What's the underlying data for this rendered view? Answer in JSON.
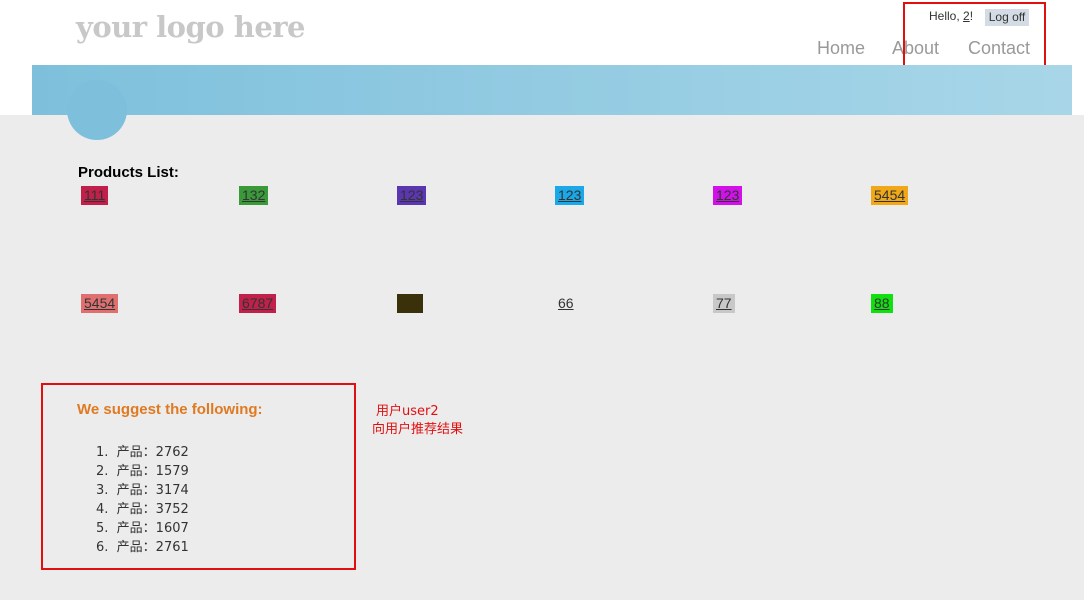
{
  "header": {
    "logo": "your logo here",
    "greeting_prefix": "Hello, ",
    "username": "2",
    "greeting_suffix": "!",
    "logoff_label": "Log off"
  },
  "nav": [
    {
      "label": "Home"
    },
    {
      "label": "About"
    },
    {
      "label": "Contact"
    }
  ],
  "products": {
    "title": "Products List:",
    "items": [
      {
        "label": "111",
        "color": "#c0204a"
      },
      {
        "label": "132",
        "color": "#3a9a3a"
      },
      {
        "label": "123",
        "color": "#5a36b0"
      },
      {
        "label": "123",
        "color": "#1aa8e8"
      },
      {
        "label": "123",
        "color": "#d012e8"
      },
      {
        "label": "5454",
        "color": "#f0a818"
      },
      {
        "label": "5454",
        "color": "#e07070"
      },
      {
        "label": "6787",
        "color": "#c0204a"
      },
      {
        "label": "",
        "color": "#3a300a"
      },
      {
        "label": "66",
        "color": ""
      },
      {
        "label": "77",
        "color": "#c8c8c8"
      },
      {
        "label": "88",
        "color": "#10e010"
      }
    ]
  },
  "suggest": {
    "title": "We suggest the following:",
    "items": [
      {
        "num": "1.",
        "text": "产品：2762"
      },
      {
        "num": "2.",
        "text": "产品：1579"
      },
      {
        "num": "3.",
        "text": "产品：3174"
      },
      {
        "num": "4.",
        "text": "产品：3752"
      },
      {
        "num": "5.",
        "text": "产品：1607"
      },
      {
        "num": "6.",
        "text": "产品：2761"
      }
    ]
  },
  "annotation": {
    "line1": "用户user2",
    "line2": "向用户推荐结果"
  }
}
